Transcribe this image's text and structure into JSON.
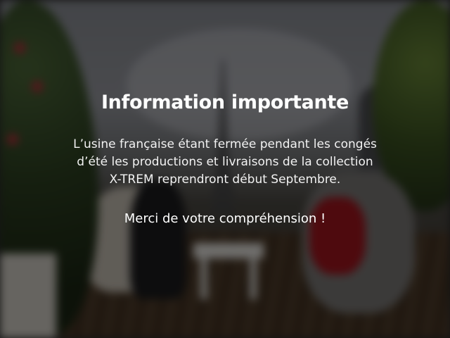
{
  "notice": {
    "title": "Information importante",
    "body_lines": [
      "L’usine française étant fermée pendant les congés",
      "d’été les productions et livraisons de la collection",
      "X-TREM reprendront début Septembre."
    ],
    "closing": "Merci de votre compréhension !"
  },
  "colors": {
    "text": "#ffffff",
    "overlay": "#000000"
  }
}
